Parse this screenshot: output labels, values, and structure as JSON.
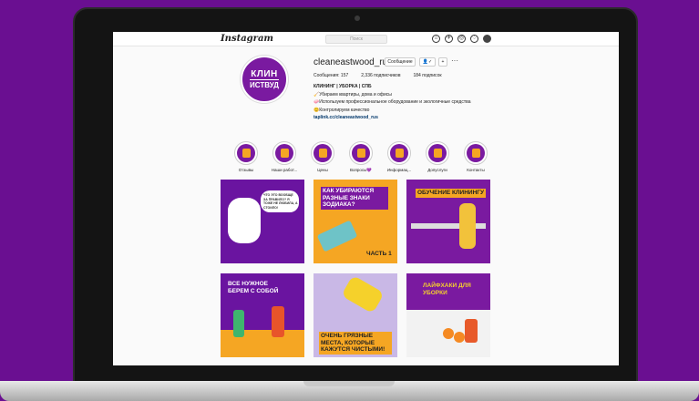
{
  "nav": {
    "logo": "Instagram",
    "search_placeholder": "Поиск"
  },
  "profile": {
    "avatar_line1": "КЛИН",
    "avatar_line2": "ИСТВУД",
    "username": "cleaneastwood_rus",
    "message_button": "Сообщение",
    "follow_button": "👤✓",
    "add_button": "+",
    "more": "···",
    "stats": {
      "posts": "Сообщения: 157",
      "followers": "2,336 подписчиков",
      "following": "184 подписок"
    },
    "bio": {
      "name": "КЛИНИНГ | УБОРКА | СПБ",
      "line1": "🧹Убираем квартиры, дома и офисы",
      "line2": "🧼Используем профессиональное оборудование и экологичные средства",
      "line3": "😊Контролируем качество",
      "link": "taplink.cc/cleaneastwood_rus"
    }
  },
  "highlights": [
    {
      "label": "Отзывы"
    },
    {
      "label": "Наши работ..."
    },
    {
      "label": "Цены"
    },
    {
      "label": "Вопросы💜"
    },
    {
      "label": "Информац..."
    },
    {
      "label": "Допуслуги"
    },
    {
      "label": "Контакты"
    }
  ],
  "posts": [
    {
      "text": "Что это вообще за правило? Я тоже не любила, а стоило!"
    },
    {
      "text": "Как убираются разные знаки зодиака?",
      "sub": "Часть 1"
    },
    {
      "text": "Обучение клинингу"
    },
    {
      "text": "Все нужное берем с собой"
    },
    {
      "text": "Очень грязные места, которые кажутся чистыми!"
    },
    {
      "text": "Лайфхаки для уборки"
    }
  ],
  "colors": {
    "brand": "#7a1aa0",
    "accent": "#f5a623",
    "background": "#6a0f91"
  }
}
